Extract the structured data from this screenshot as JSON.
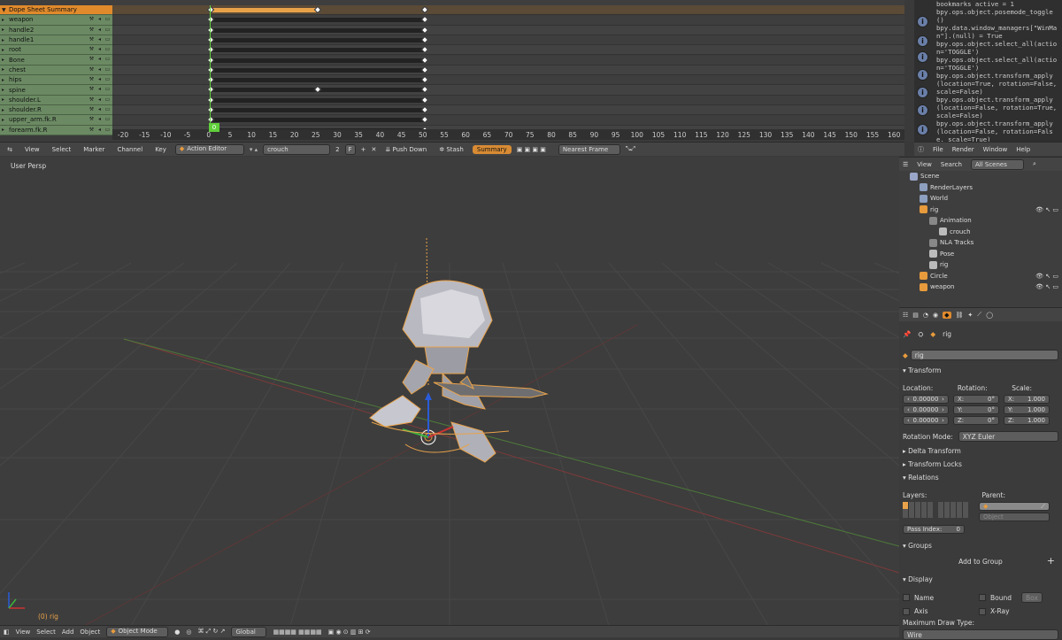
{
  "dopesheet": {
    "summary_label": "Dope Sheet Summary",
    "channels": [
      "weapon",
      "handle2",
      "handle1",
      "root",
      "Bone",
      "chest",
      "hips",
      "spine",
      "shoulder.L",
      "shoulder.R",
      "upper_arm.fk.R",
      "forearm.fk.R"
    ],
    "ruler_ticks": [
      "-20",
      "-15",
      "-10",
      "-5",
      "0",
      "5",
      "10",
      "15",
      "20",
      "25",
      "30",
      "35",
      "40",
      "45",
      "50",
      "55",
      "60",
      "65",
      "70",
      "75",
      "80",
      "85",
      "90",
      "95",
      "100",
      "105",
      "110",
      "115",
      "120",
      "125",
      "130",
      "135",
      "140",
      "145",
      "150",
      "155",
      "160"
    ],
    "current_frame": "0"
  },
  "dope_header": {
    "view": "View",
    "select": "Select",
    "marker": "Marker",
    "channel": "Channel",
    "key": "Key",
    "mode": "Action Editor",
    "action_name": "crouch",
    "action_users": "2",
    "fake_user": "F",
    "push_down": "Push Down",
    "stash": "Stash",
    "summary": "Summary",
    "snap": "Nearest Frame"
  },
  "console": {
    "lines": [
      "bookmarks active = 1",
      "bpy.ops.object.posemode_toggle()",
      "bpy.data.window_managers[\"WinMan\"].(null) = True",
      "bpy.ops.object.select_all(action='TOGGLE')",
      "bpy.ops.object.select_all(action='TOGGLE')",
      "bpy.ops.object.transform_apply(location=True, rotation=False, scale=False)",
      "bpy.ops.object.transform_apply(location=False, rotation=True, scale=False)",
      "bpy.ops.object.transform_apply(location=False, rotation=False, scale=True)"
    ]
  },
  "info_header": {
    "file": "File",
    "render": "Render",
    "window": "Window",
    "help": "Help"
  },
  "viewport": {
    "persp_label": "User Persp",
    "object_label": "(0) rig"
  },
  "viewport_header": {
    "view": "View",
    "select": "Select",
    "add": "Add",
    "object": "Object",
    "mode": "Object Mode",
    "orientation": "Global"
  },
  "outliner": {
    "view": "View",
    "search": "Search",
    "filter": "All Scenes",
    "items": [
      "Scene",
      "RenderLayers",
      "World",
      "rig",
      "Animation",
      "crouch",
      "NLA Tracks",
      "Pose",
      "rig",
      "Circle",
      "weapon"
    ]
  },
  "properties": {
    "object_name": "rig",
    "name_field": "rig",
    "transform": "Transform",
    "location_label": "Location:",
    "rotation_label": "Rotation:",
    "scale_label": "Scale:",
    "loc": [
      "0.00000",
      "0.00000",
      "0.00000"
    ],
    "rot_axes": [
      "X:",
      "Y:",
      "Z:"
    ],
    "rot": [
      "0°",
      "0°",
      "0°"
    ],
    "scale_axes": [
      "X:",
      "Y:",
      "Z:"
    ],
    "scale": [
      "1.000",
      "1.000",
      "1.000"
    ],
    "rotation_mode_label": "Rotation Mode:",
    "rotation_mode": "XYZ Euler",
    "delta_transform": "Delta Transform",
    "transform_locks": "Transform Locks",
    "relations": "Relations",
    "layers_label": "Layers:",
    "parent_label": "Parent:",
    "parent_type": "Object",
    "pass_index_label": "Pass Index:",
    "pass_index": "0",
    "groups": "Groups",
    "add_to_group": "Add to Group",
    "display": "Display",
    "name_cb": "Name",
    "bound_cb": "Bound",
    "bound_type": "Box",
    "axis_cb": "Axis",
    "xray_cb": "X-Ray",
    "max_draw_label": "Maximum Draw Type:",
    "max_draw": "Wire"
  }
}
